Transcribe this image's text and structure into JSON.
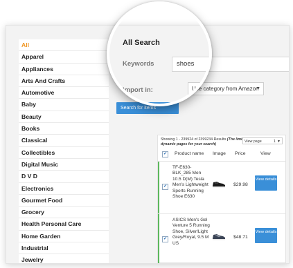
{
  "categories": [
    "All",
    "Apparel",
    "Appliances",
    "Arts And Crafts",
    "Automotive",
    "Baby",
    "Beauty",
    "Books",
    "Classical",
    "Collectibles",
    "Digital Music",
    "D V D",
    "Electronics",
    "Gourmet Food",
    "Grocery",
    "Health Personal Care",
    "Home Garden",
    "Industrial",
    "Jewelry"
  ],
  "search": {
    "title": "All Search",
    "keywords_label": "Keywords",
    "keywords_value": "shoes",
    "import_label": "Import in:",
    "import_value": "Use category from Amazon",
    "button_label": "Search for items"
  },
  "results": {
    "showing_text": "Showing 1 - 239924 of 2399234 Results",
    "showing_note": "(The limit of dynamic pages for your search)",
    "per_page_label": "View page",
    "per_page_value": "1",
    "columns": {
      "product": "Product name",
      "image": "Image",
      "price": "Price",
      "view": "View"
    },
    "rows": [
      {
        "name": "TF-E630-BLK_285 Men 10.5 D(M) Tesla Men's Lightweight Sports Running Shoe E630",
        "price": "$29.98",
        "button": "View details",
        "checked": true
      },
      {
        "name": "ASICS Men's Gel Venture 5 Running Shoe, Silver/Light Grey/Royal, 9.5 M US",
        "price": "$48.71",
        "button": "View details",
        "checked": true
      }
    ]
  },
  "icons": {
    "checkbox": "checkbox-checked-icon",
    "dropdown": "chevron-down-icon",
    "shoe": "shoe-product-image"
  },
  "colors": {
    "accent": "#f0931e",
    "primary_button": "#3a8fd8",
    "row_marker": "#5cb85c"
  }
}
